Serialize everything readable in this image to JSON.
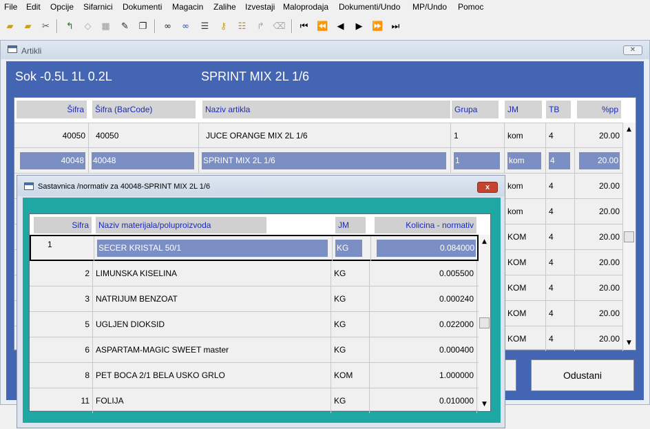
{
  "menu": [
    "File",
    "Edit",
    "Opcije",
    "Sifarnici",
    "Dokumenti",
    "Magacin",
    "Zalihe",
    "Izvestaji",
    "Maloprodaja",
    "Dokumenti/Undo",
    "MP/Undo",
    "Pomoc"
  ],
  "toolbar_icons": [
    "open-folder-icon",
    "folder-arrow-icon",
    "tools-icon",
    "undo-icon",
    "diamond-icon",
    "table-icon",
    "edit-icon",
    "copy-icon",
    "binoculars-icon",
    "binoculars-plus-icon",
    "list-icon",
    "key-icon",
    "database-icon",
    "return-arrow-icon",
    "eraser-icon",
    "first-record-icon",
    "prev-page-icon",
    "prev-record-icon",
    "next-record-icon",
    "next-page-icon",
    "last-record-icon"
  ],
  "artikli": {
    "title": "Artikli",
    "header_left": "Sok -0.5L 1L 0.2L",
    "header_right": "SPRINT MIX 2L 1/6",
    "columns": [
      "Šifra",
      "Šifra (BarCode)",
      "Naziv artikla",
      "Grupa",
      "JM",
      "TB",
      "%pp"
    ],
    "rows": [
      {
        "sifra": "40050",
        "barcode": "40050",
        "naziv": "JUCE ORANGE MIX 2L 1/6",
        "grupa": "1",
        "jm": "kom",
        "tb": "4",
        "pp": "20.00"
      },
      {
        "sifra": "40048",
        "barcode": "40048",
        "naziv": "SPRINT MIX 2L 1/6",
        "grupa": "1",
        "jm": "kom",
        "tb": "4",
        "pp": "20.00"
      },
      {
        "sifra": "",
        "barcode": "",
        "naziv": "",
        "grupa": "",
        "jm": "kom",
        "tb": "4",
        "pp": "20.00"
      },
      {
        "sifra": "",
        "barcode": "",
        "naziv": "",
        "grupa": "",
        "jm": "kom",
        "tb": "4",
        "pp": "20.00"
      },
      {
        "sifra": "",
        "barcode": "",
        "naziv": "",
        "grupa": "",
        "jm": "KOM",
        "tb": "4",
        "pp": "20.00"
      },
      {
        "sifra": "",
        "barcode": "",
        "naziv": "",
        "grupa": "",
        "jm": "KOM",
        "tb": "4",
        "pp": "20.00"
      },
      {
        "sifra": "",
        "barcode": "",
        "naziv": "",
        "grupa": "",
        "jm": "KOM",
        "tb": "4",
        "pp": "20.00"
      },
      {
        "sifra": "",
        "barcode": "",
        "naziv": "",
        "grupa": "",
        "jm": "KOM",
        "tb": "4",
        "pp": "20.00"
      },
      {
        "sifra": "",
        "barcode": "",
        "naziv": "",
        "grupa": "",
        "jm": "KOM",
        "tb": "4",
        "pp": "20.00"
      }
    ],
    "cancel_label": "Odustani"
  },
  "sastavnica": {
    "title": "Sastavnica /normativ za 40048-SPRINT MIX 2L 1/6",
    "close_label": "x",
    "columns": [
      "Sifra",
      "Naziv materijala/poluproizvoda",
      "JM",
      "Kolicina - normativ"
    ],
    "rows": [
      {
        "sifra": "1",
        "naziv": "SECER KRISTAL 50/1",
        "jm": "KG",
        "kolicina": "0.084000"
      },
      {
        "sifra": "2",
        "naziv": "LIMUNSKA KISELINA",
        "jm": "KG",
        "kolicina": "0.005500"
      },
      {
        "sifra": "3",
        "naziv": "NATRIJUM BENZOAT",
        "jm": "KG",
        "kolicina": "0.000240"
      },
      {
        "sifra": "5",
        "naziv": "UGLJEN DIOKSID",
        "jm": "KG",
        "kolicina": "0.022000"
      },
      {
        "sifra": "6",
        "naziv": "ASPARTAM-MAGIC SWEET master",
        "jm": "KG",
        "kolicina": "0.000400"
      },
      {
        "sifra": "8",
        "naziv": "PET BOCA 2/1 BELA USKO GRLO",
        "jm": "KOM",
        "kolicina": "1.000000"
      },
      {
        "sifra": "11",
        "naziv": "FOLIJA",
        "jm": "KG",
        "kolicina": "0.010000"
      }
    ]
  },
  "colors": {
    "window_blue": "#4465b4",
    "teal": "#1fa7a4",
    "selection": "#7b8fc4",
    "header_text": "#1a29c2"
  }
}
